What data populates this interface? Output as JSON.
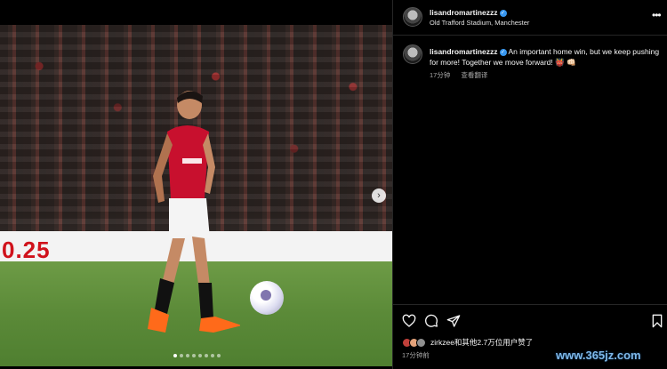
{
  "post": {
    "username": "lisandromartinezzz",
    "location": "Old Trafford Stadium, Manchester",
    "more_label": "•••",
    "caption": "An important home win, but we keep pushing for more! Together we move forward! 👹 👊🏻",
    "caption_time": "17分钟",
    "translate_label": "查看翻译",
    "likes_text": "zirkzee和其他2.7万位用户赞了",
    "post_time": "17分钟前"
  },
  "photo": {
    "banner_text": "0.25",
    "next_label": "›",
    "slide_count": 8,
    "active_slide": 0
  },
  "watermark": "www.365jz.com",
  "icons": {
    "like": "heart-icon",
    "comment": "comment-icon",
    "share": "send-icon",
    "save": "bookmark-icon"
  },
  "colors": {
    "background": "#000000",
    "verified": "#3897f0",
    "secondary_text": "#a8a8a8"
  }
}
